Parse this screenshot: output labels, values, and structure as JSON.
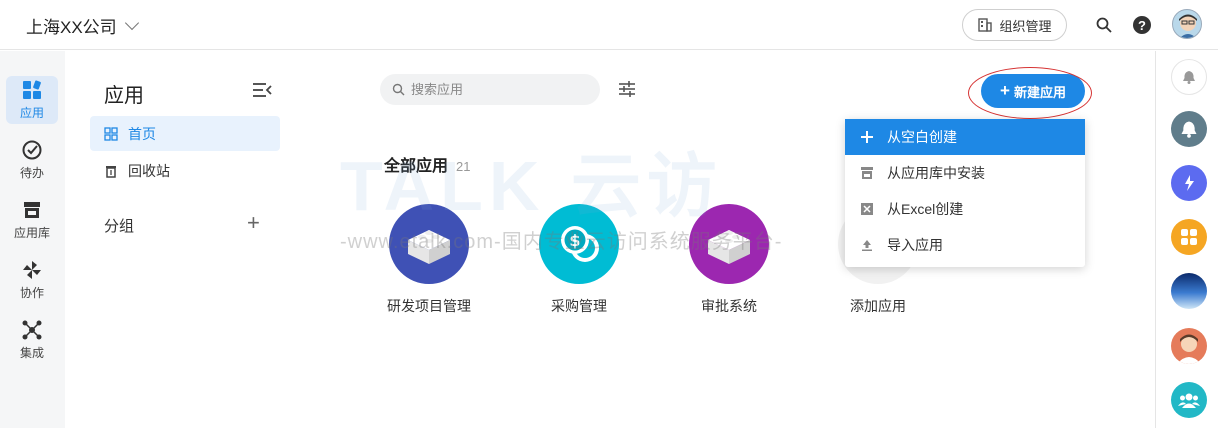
{
  "header": {
    "company": "上海XX公司",
    "org_button": "组织管理"
  },
  "leftnav": {
    "items": [
      {
        "label": "应用"
      },
      {
        "label": "待办"
      },
      {
        "label": "应用库"
      },
      {
        "label": "协作"
      },
      {
        "label": "集成"
      }
    ]
  },
  "sidebar": {
    "title": "应用",
    "items": [
      {
        "label": "首页"
      },
      {
        "label": "回收站"
      }
    ],
    "group_title": "分组"
  },
  "main": {
    "search_placeholder": "搜索应用",
    "new_button": "新建应用",
    "section_title": "全部应用",
    "section_count": "21",
    "apps": [
      {
        "name": "研发项目管理",
        "color": "#3f51b5"
      },
      {
        "name": "采购管理",
        "color": "#00bcd4"
      },
      {
        "name": "审批系统",
        "color": "#9c27b0"
      },
      {
        "name": "添加应用"
      }
    ]
  },
  "menu": {
    "items": [
      {
        "label": "从空白创建"
      },
      {
        "label": "从应用库中安装"
      },
      {
        "label": "从Excel创建"
      },
      {
        "label": "导入应用"
      }
    ]
  },
  "watermark": {
    "logo": "TALK 云访",
    "line": "-www.etalk.com-国内专业云访问系统服务平台-"
  },
  "colors": {
    "accent": "#1e88e5",
    "highlight_ring": "#d63434"
  }
}
